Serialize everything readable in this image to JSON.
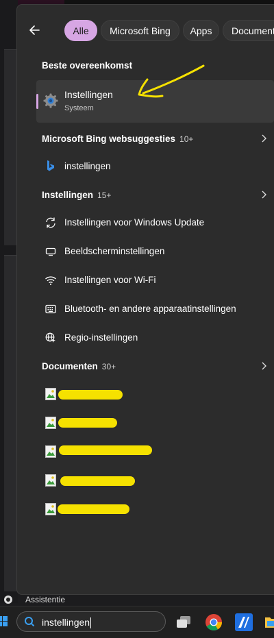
{
  "tabs": [
    "Alle",
    "Microsoft Bing",
    "Apps",
    "Documenten"
  ],
  "best_match": {
    "heading": "Beste overeenkomst",
    "title": "Instellingen",
    "subtitle": "Systeem"
  },
  "bing": {
    "heading": "Microsoft Bing websuggesties",
    "count": "10+",
    "item": "instellingen"
  },
  "settings": {
    "heading": "Instellingen",
    "count": "15+",
    "items": [
      "Instellingen voor Windows Update",
      "Beeldscherminstellingen",
      "Instellingen voor Wi-Fi",
      "Bluetooth- en andere apparaatinstellingen",
      "Regio-instellingen"
    ]
  },
  "documents": {
    "heading": "Documenten",
    "count": "30+"
  },
  "assistant_label": "Assistentie",
  "taskbar": {
    "search_value": "instellingen"
  },
  "colors": {
    "accent": "#d7a6e4",
    "annotation": "#f5e100",
    "panel": "#2c2c2c"
  },
  "icons": {
    "back": "back-arrow-icon",
    "gear": "gear-icon",
    "bing": "bing-icon",
    "update": "refresh-icon",
    "display": "monitor-icon",
    "wifi": "wifi-icon",
    "bluetooth": "keyboard-device-icon",
    "region": "globe-icon",
    "document": "image-document-icon"
  }
}
